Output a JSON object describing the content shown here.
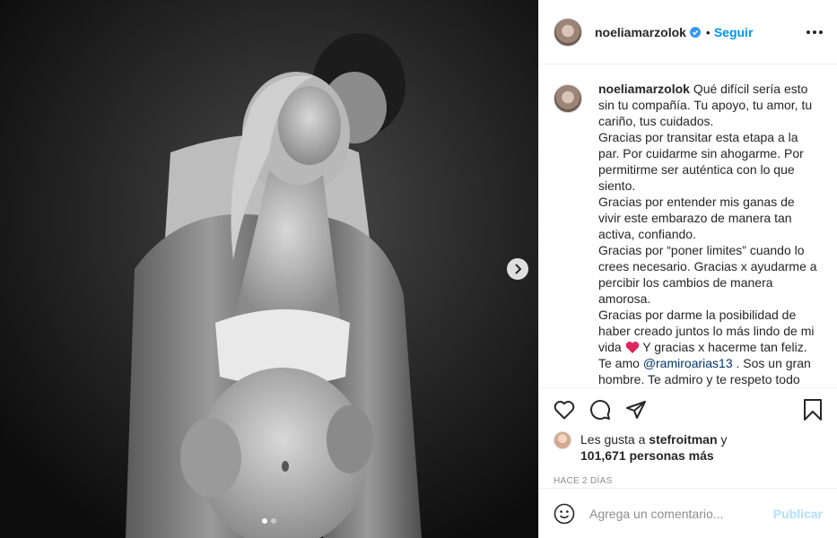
{
  "header": {
    "username": "noeliamarzolok",
    "separator": "•",
    "follow_label": "Seguir"
  },
  "caption": {
    "username": "noeliamarzolok",
    "lines": [
      "Qué difícil sería esto",
      "sin tu compañía. Tu apoyo, tu amor, tu",
      "cariño, tus cuidados.",
      "Gracias por transitar esta etapa a la",
      "par. Por cuidarme sin ahogarme. Por",
      "permitirme ser auténtica con lo que",
      "siento.",
      "Gracias por entender mis ganas de",
      "vivir este embarazo de manera tan",
      "activa, confiando.",
      "Gracias por “poner limites” cuando lo",
      "crees necesario. Gracias x ayudarme a",
      "percibir los cambios de manera",
      "amorosa.",
      "Gracias por darme la posibilidad de",
      "haber creado juntos lo más lindo de mi"
    ],
    "line_vida_pre": "vida",
    "line_vida_post": " Y gracias x hacerme tan feliz.",
    "line_teamo_pre": "Te amo ",
    "mention": "@ramiroarias13",
    "line_teamo_post": " . Sos un gran",
    "line_cut": "hombre. Te admiro y te respeto todo"
  },
  "likes": {
    "prefix": "Les gusta a ",
    "user": "stefroitman",
    "mid": " y",
    "count": "101,671 personas más"
  },
  "timestamp": "Hace 2 días",
  "comment_input": {
    "placeholder": "Agrega un comentario..."
  },
  "post_label": "Publicar",
  "carousel": {
    "total": 2,
    "current": 1
  },
  "colors": {
    "link": "#0095f6",
    "heart": "#ed4956",
    "post_disabled": "#b2dffc"
  }
}
